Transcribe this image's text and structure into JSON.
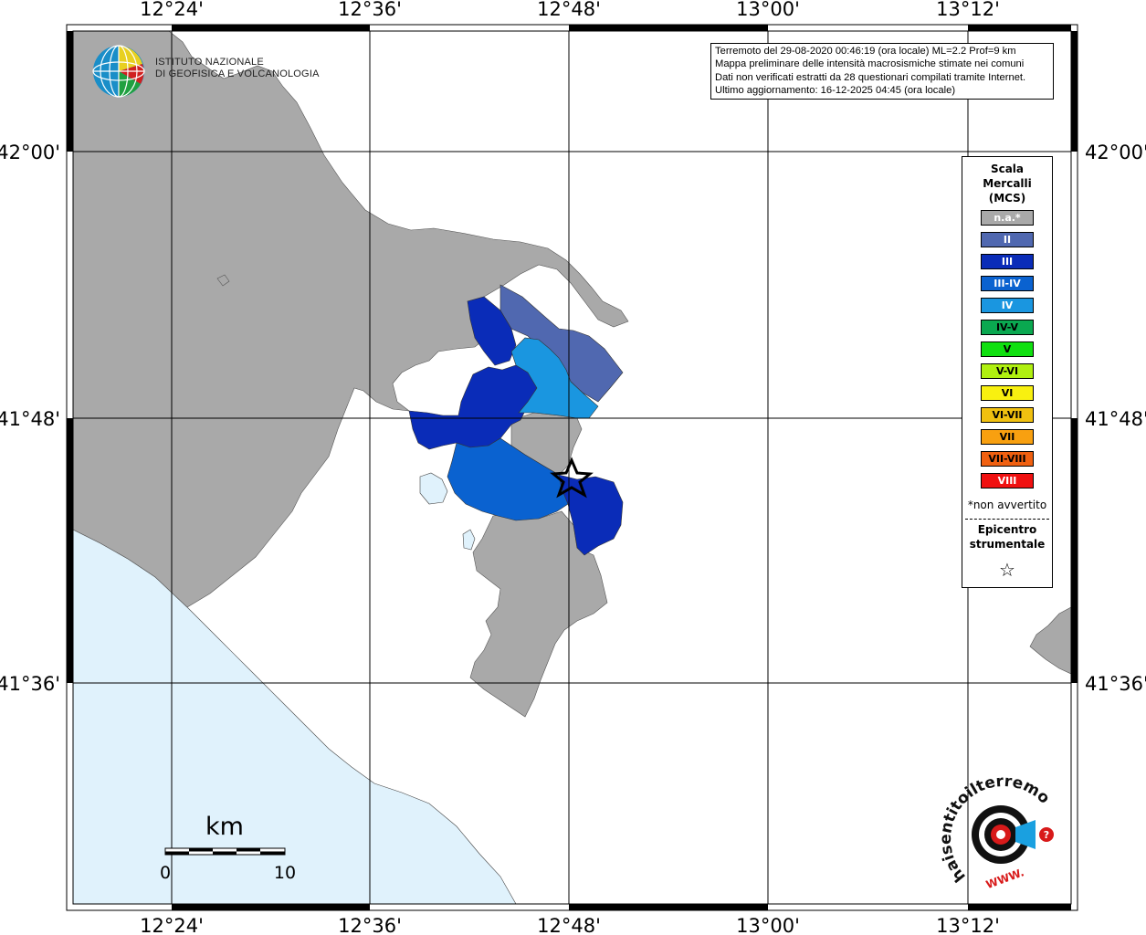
{
  "map": {
    "x_ticks": [
      "12°24'",
      "12°36'",
      "12°48'",
      "13°00'",
      "13°12'"
    ],
    "y_ticks": [
      "42°00'",
      "41°48'",
      "41°36'"
    ],
    "colors": {
      "land_outside": "#a9a9a9",
      "sea": "#e0f2fc",
      "unaffected_land": "#ffffff",
      "grid": "#000000"
    }
  },
  "info": {
    "line1": "Terremoto del 29-08-2020 00:46:19 (ora locale) ML=2.2 Prof=9 km",
    "line2": "Mappa preliminare delle intensità macrosismiche stimate nei comuni",
    "line3": "Dati non verificati estratti da 28 questionari compilati tramite Internet.",
    "line4": "Ultimo aggiornamento: 16-12-2025 04:45 (ora locale)"
  },
  "legend": {
    "title_line1": "Scala",
    "title_line2": "Mercalli",
    "title_line3": "(MCS)",
    "items": [
      {
        "label": "n.a.*",
        "color": "#a9a9a9",
        "text_color": "#ffffff"
      },
      {
        "label": "II",
        "color": "#5068b0",
        "text_color": "#ffffff"
      },
      {
        "label": "III",
        "color": "#0a2cb8",
        "text_color": "#ffffff"
      },
      {
        "label": "III-IV",
        "color": "#0a62d0",
        "text_color": "#ffffff"
      },
      {
        "label": "IV",
        "color": "#1a96e0",
        "text_color": "#ffffff"
      },
      {
        "label": "IV-V",
        "color": "#0aa850",
        "text_color": "#000000"
      },
      {
        "label": "V",
        "color": "#10e010",
        "text_color": "#000000"
      },
      {
        "label": "V-VI",
        "color": "#b0f010",
        "text_color": "#000000"
      },
      {
        "label": "VI",
        "color": "#f8f010",
        "text_color": "#000000"
      },
      {
        "label": "VI-VII",
        "color": "#f0c010",
        "text_color": "#000000"
      },
      {
        "label": "VII",
        "color": "#f8a010",
        "text_color": "#000000"
      },
      {
        "label": "VII-VIII",
        "color": "#f06010",
        "text_color": "#000000"
      },
      {
        "label": "VIII",
        "color": "#f01010",
        "text_color": "#ffffff"
      }
    ],
    "not_felt_note": "*non avvertito",
    "epicenter_line1": "Epicentro",
    "epicenter_line2": "strumentale",
    "epicenter_symbol": "☆"
  },
  "scale_bar": {
    "unit": "km",
    "start": "0",
    "end": "10"
  },
  "ingv": {
    "line1": "ISTITUTO NAZIONALE",
    "line2": "DI GEOFISICA E VOLCANOLOGIA"
  },
  "haisentito": {
    "text": "haisentitoilterremoto.it",
    "www": "WWW."
  }
}
